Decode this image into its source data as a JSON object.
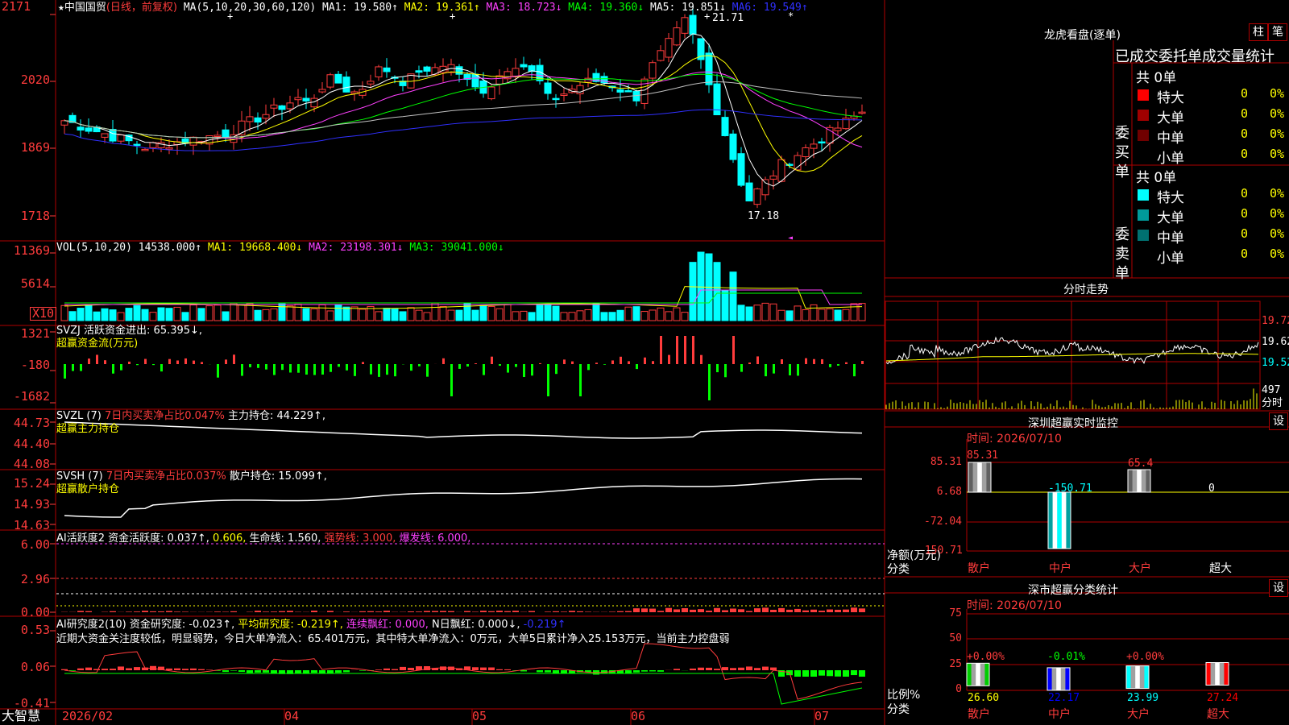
{
  "main_chart": {
    "star": "★",
    "stock_name": "中国国贸",
    "period": "(日线，前复权)",
    "ma_head": "MA(5,10,20,30,60,120)",
    "ma1": "MA1: 19.580↑",
    "ma2": "MA2: 19.361↑",
    "ma3": "MA3: 18.723↓",
    "ma4": "MA4: 19.360↓",
    "ma5": "MA5: 19.851↓",
    "ma6": "MA6: 19.549↑",
    "y_labels": [
      "2171",
      "2020",
      "1869",
      "1718"
    ],
    "high_label": "21.71",
    "low_label": "17.18"
  },
  "vol_panel": {
    "head": "VOL(5,10,20)",
    "value": "14538.000↑",
    "ma1": "MA1: 19668.400↓",
    "ma2": "MA2: 23198.301↓",
    "ma3": "MA3: 39041.000↓",
    "y_labels": [
      "11369",
      "5614"
    ],
    "unit": "X10"
  },
  "svzj_panel": {
    "head": "SVZJ",
    "line1": "活跃资金进出: 65.395↓,",
    "line2": "超赢资金流(万元)",
    "y_labels": [
      "1321",
      "-180",
      "-1682"
    ]
  },
  "svzl_panel": {
    "head": "SVZL (7)",
    "ratio": "7日内买卖净占比0.047%",
    "hold": "主力持仓: 44.229↑,",
    "line2": "超赢主力持仓",
    "y_labels": [
      "44.73",
      "44.40",
      "44.08"
    ]
  },
  "svsh_panel": {
    "head": "SVSH (7)",
    "ratio": "7日内买卖净占比0.037%",
    "hold": "散户持仓: 15.099↑,",
    "line2": "超赢散户持仓",
    "y_labels": [
      "15.24",
      "14.93",
      "14.63"
    ]
  },
  "ai_active_panel": {
    "head": "AI活跃度2",
    "a": "资金活跃度: 0.037↑,",
    "b": "0.606,",
    "c": "生命线: 1.560,",
    "d": "强势线: 3.000,",
    "e": "爆发线: 6.000,",
    "y_labels": [
      "6.00",
      "2.96",
      "0.00"
    ]
  },
  "ai_research_panel": {
    "head": "AI研究度2(10)",
    "a": "资金研究度: -0.023↑,",
    "b": "平均研究度: -0.219↑,",
    "c": "连续飘红: 0.000,",
    "d": "N日飘红: 0.000↓,",
    "e": "-0.219↑",
    "comment": "近期大资金关注度较低，明显弱势，今日大单净流入：65.401万元，其中特大单净流入：0万元，大单5日累计净入25.153万元，当前主力控盘弱",
    "y_labels": [
      "0.53",
      "0.06",
      "-0.41"
    ]
  },
  "x_axis": {
    "labels": [
      "2026/02",
      "04",
      "05",
      "06",
      "07"
    ],
    "brand": "大智慧"
  },
  "right_panel": {
    "lhb_title": "龙虎看盘(逐单)",
    "btn_zhu": "柱",
    "btn_bi": "笔",
    "tabs_text": "已成交委托单成交量统计",
    "buy_label": "委买单",
    "sell_label": "委卖单",
    "buy_total": "共 0单",
    "sell_total": "共 0单",
    "buy_rows": [
      {
        "name": "特大",
        "qty": "0",
        "pct": "0%",
        "color": "#ff0000"
      },
      {
        "name": "大单",
        "qty": "0",
        "pct": "0%",
        "color": "#a00000"
      },
      {
        "name": "中单",
        "qty": "0",
        "pct": "0%",
        "color": "#700000"
      },
      {
        "name": "小单",
        "qty": "0",
        "pct": "0%",
        "color": "#000000"
      }
    ],
    "sell_rows": [
      {
        "name": "特大",
        "qty": "0",
        "pct": "0%",
        "color": "#00ffff"
      },
      {
        "name": "大单",
        "qty": "0",
        "pct": "0%",
        "color": "#009a9a"
      },
      {
        "name": "中单",
        "qty": "0",
        "pct": "0%",
        "color": "#007070"
      },
      {
        "name": "小单",
        "qty": "0",
        "pct": "0%",
        "color": "#000000"
      }
    ],
    "intraday_title": "分时走势",
    "intraday_labels": [
      "19.72",
      "19.62",
      "19.52"
    ],
    "intraday_vol": "497",
    "intraday_vol_unit": "分时",
    "monitor_title": "深圳超赢实时监控",
    "monitor_btn": "设",
    "monitor_time": "时间: 2026/07/10",
    "monitor_y": [
      "85.31",
      "6.68",
      "-72.04",
      "-150.71"
    ],
    "monitor_unit": "净额(万元)",
    "monitor_unit2": "分类",
    "monitor_bars": [
      {
        "cat": "散户",
        "value": "85.31"
      },
      {
        "cat": "中户",
        "value": "-150.71"
      },
      {
        "cat": "大户",
        "value": "65.4"
      },
      {
        "cat": "超大",
        "value": "0"
      }
    ],
    "stat_title": "深市超赢分类统计",
    "stat_btn": "设",
    "stat_time": "时间: 2026/07/10",
    "stat_y": [
      "75",
      "50",
      "25",
      "0"
    ],
    "stat_unit": "比例%",
    "stat_unit2": "分类",
    "stat_bars": [
      {
        "cat": "散户",
        "top": "+0.00%",
        "bottom": "26.60",
        "value": 26.6,
        "color": "#00cc00"
      },
      {
        "cat": "中户",
        "top": "-0.01%",
        "bottom": "22.17",
        "value": 22.17,
        "color": "#0000ff"
      },
      {
        "cat": "大户",
        "top": "+0.00%",
        "bottom": "23.99",
        "value": 23.99,
        "color": "#00ffff"
      },
      {
        "cat": "超大",
        "top": "",
        "bottom": "27.24",
        "value": 27.24,
        "color": "#ff0000"
      }
    ]
  }
}
